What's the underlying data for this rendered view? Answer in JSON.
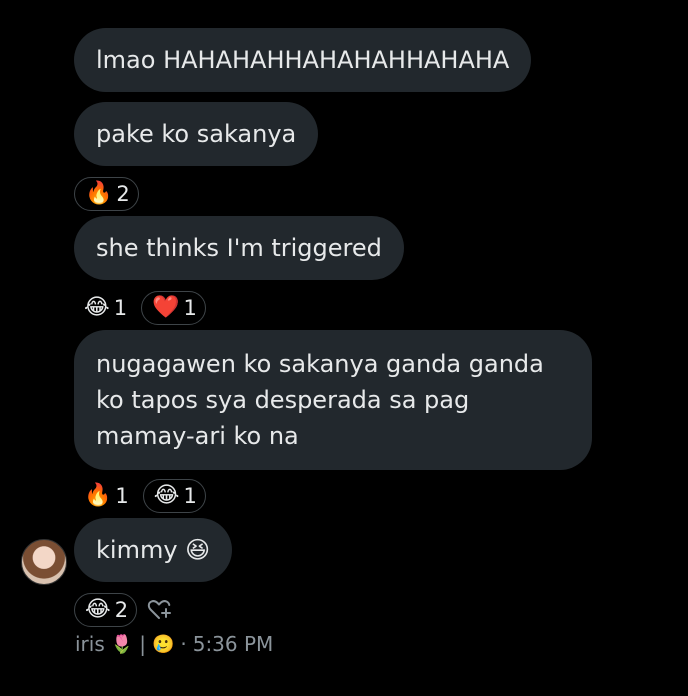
{
  "messages": [
    {
      "text": "lmao HAHAHAHHAHAHAHHAHAHA"
    },
    {
      "text": "pake ko sakanya"
    },
    {
      "text": "she thinks I'm triggered"
    },
    {
      "text": "nugagawen ko sakanya ganda ganda ko tapos sya desperada sa pag mamay-ari ko na"
    },
    {
      "text": "kimmy 😆"
    }
  ],
  "reactions": {
    "r1": [
      {
        "emoji": "🔥",
        "count": "2",
        "icon": "fire-icon"
      }
    ],
    "r2": [
      {
        "emoji": "😂",
        "count": "1",
        "icon": "tears-of-joy-icon"
      },
      {
        "emoji": "❤️",
        "count": "1",
        "icon": "heart-icon"
      }
    ],
    "r3": [
      {
        "emoji": "🔥",
        "count": "1",
        "icon": "fire-icon"
      },
      {
        "emoji": "😂",
        "count": "1",
        "icon": "tears-of-joy-icon"
      }
    ],
    "r4": [
      {
        "emoji": "😂",
        "count": "2",
        "icon": "tears-of-joy-icon"
      }
    ]
  },
  "meta": {
    "sender": "iris",
    "sender_emoji": "🌷",
    "separator": "|",
    "status_emoji": "🥲",
    "dot": "·",
    "time": "5:36 PM"
  },
  "colors": {
    "background": "#000000",
    "bubble": "#22282d",
    "text": "#e7e9ea",
    "muted": "#8b949b"
  }
}
